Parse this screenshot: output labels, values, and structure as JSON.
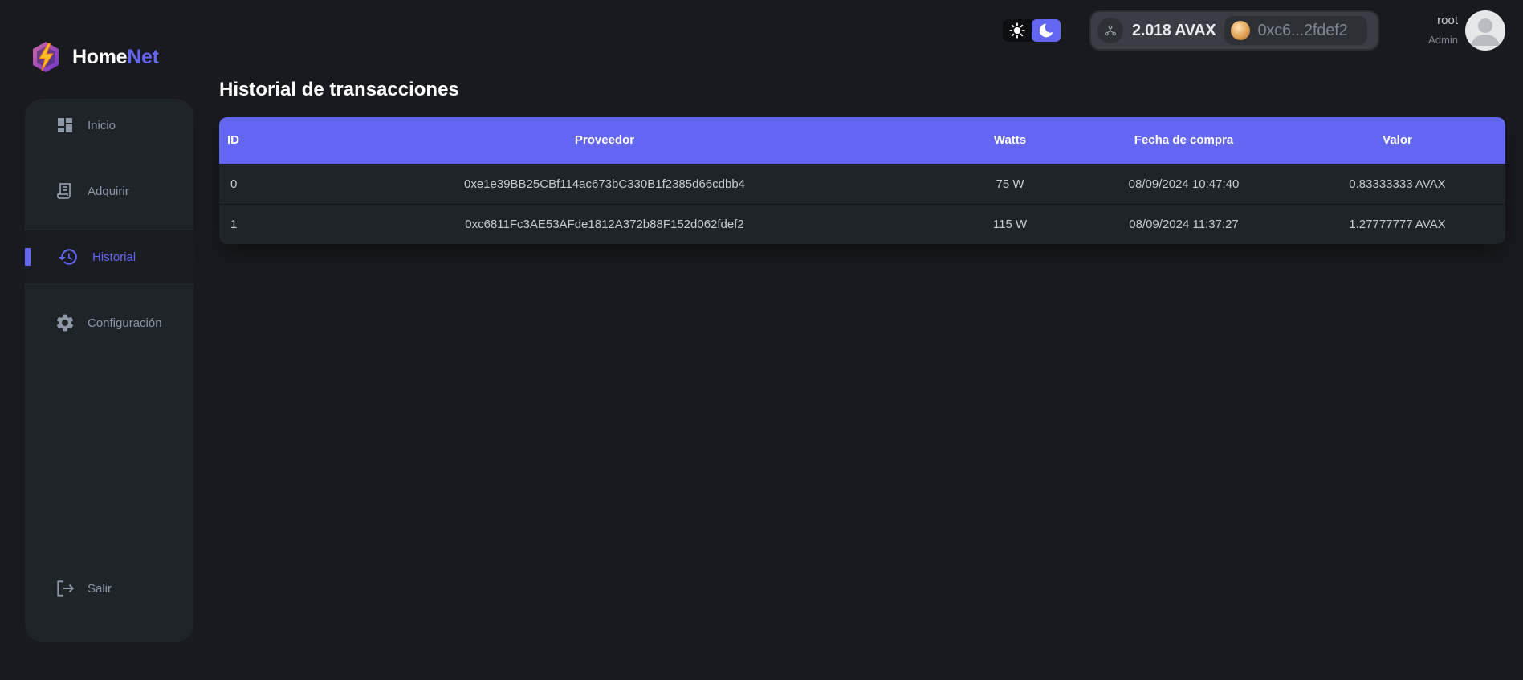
{
  "app": {
    "brand_home": "Home",
    "brand_net": "Net"
  },
  "sidebar": {
    "items": [
      {
        "label": "Inicio",
        "icon": "dashboard-icon"
      },
      {
        "label": "Adquirir",
        "icon": "receipt-icon"
      },
      {
        "label": "Historial",
        "icon": "history-icon",
        "active": true
      },
      {
        "label": "Configuración",
        "icon": "gear-icon"
      }
    ],
    "logout": {
      "label": "Salir",
      "icon": "logout-icon"
    }
  },
  "header": {
    "theme": {
      "light_icon": "sun-icon",
      "dark_icon": "moon-icon",
      "selected": "dark"
    },
    "wallet": {
      "balance": "2.018 AVAX",
      "address": "0xc6...2fdef2"
    },
    "user": {
      "name": "root",
      "role": "Admin"
    }
  },
  "main": {
    "title": "Historial de transacciones",
    "table": {
      "columns": [
        "ID",
        "Proveedor",
        "Watts",
        "Fecha de compra",
        "Valor"
      ],
      "rows": [
        {
          "id": "0",
          "provider": "0xe1e39BB25CBf114ac673bC330B1f2385d66cdbb4",
          "watts": "75 W",
          "date": "08/09/2024 10:47:40",
          "value": "0.83333333 AVAX"
        },
        {
          "id": "1",
          "provider": "0xc6811Fc3AE53AFde1812A372b88F152d062fdef2",
          "watts": "115 W",
          "date": "08/09/2024 11:37:27",
          "value": "1.27777777 AVAX"
        }
      ]
    }
  },
  "colors": {
    "accent": "#6366f1",
    "background": "#181a1f",
    "panel": "#1f2428"
  }
}
